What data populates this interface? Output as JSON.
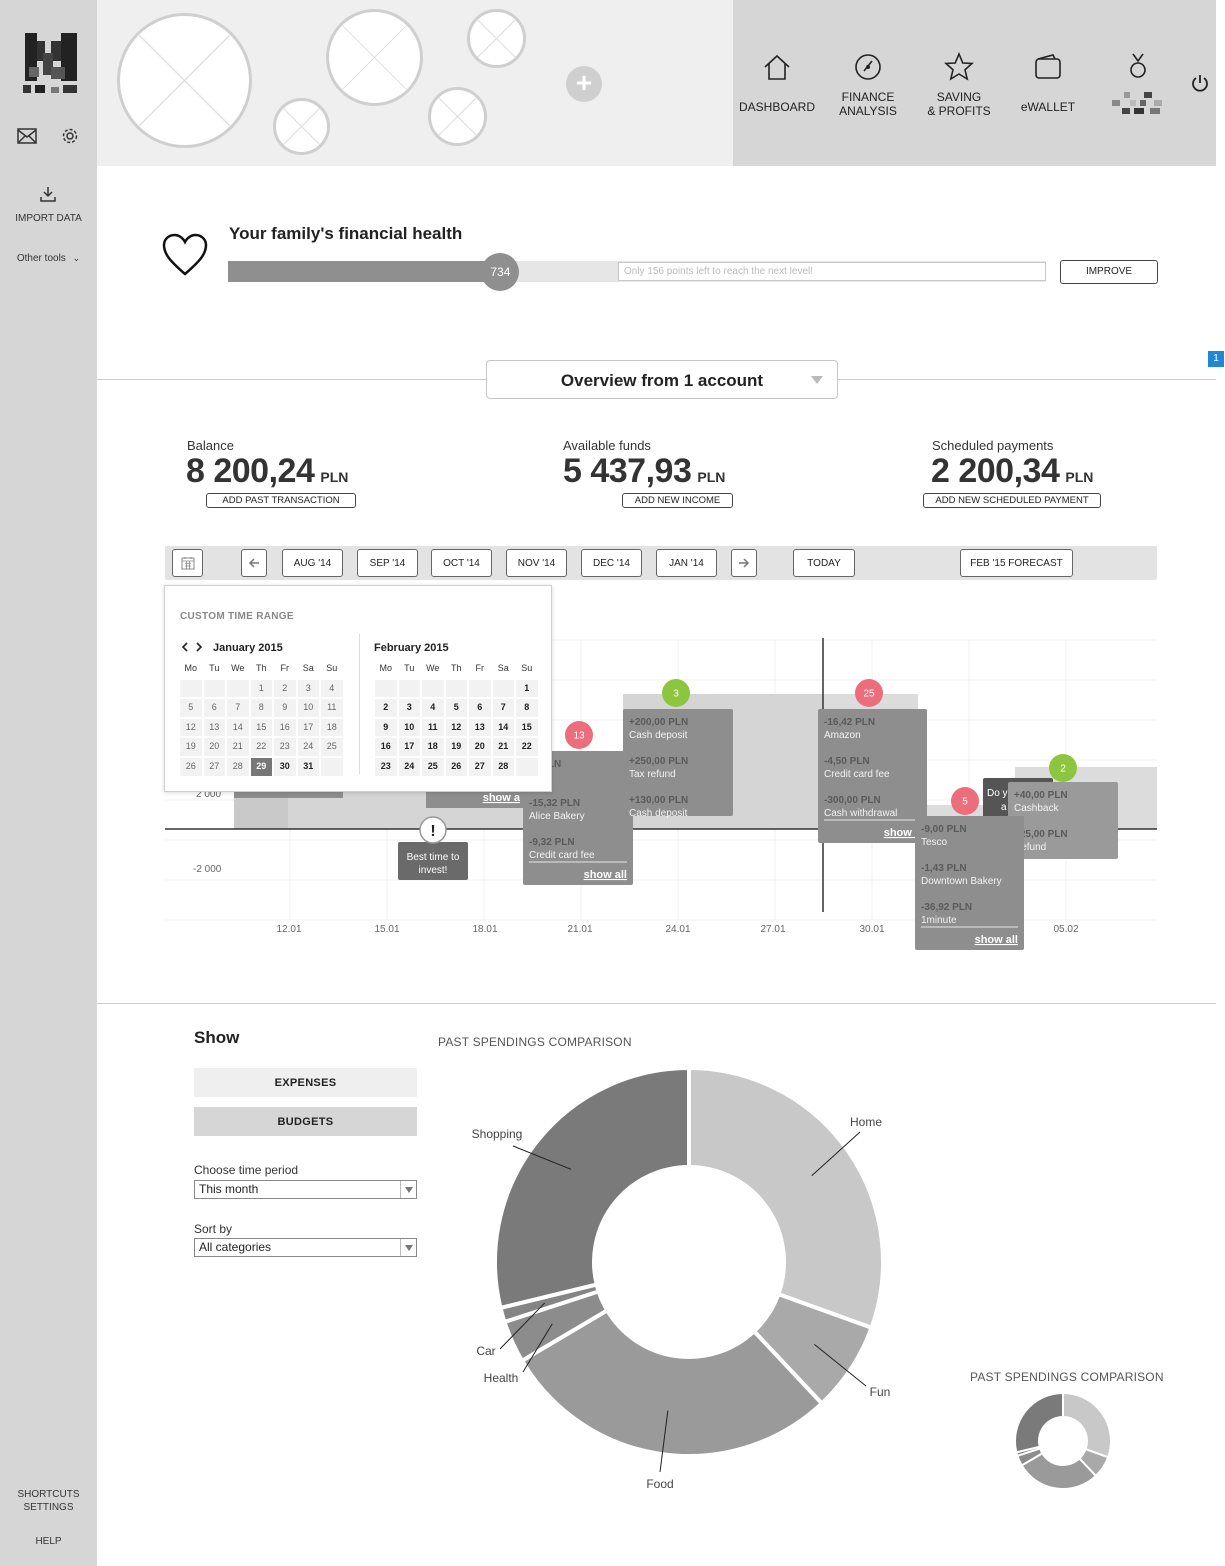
{
  "sidebar": {
    "logo": "logo-mark",
    "import_label": "IMPORT DATA",
    "other_tools_label": "Other tools",
    "shortcuts_label_1": "SHORTCUTS",
    "shortcuts_label_2": "SETTINGS",
    "help_label": "HELP"
  },
  "header": {
    "add_symbol": "+",
    "nav": [
      {
        "label1": "DASHBOARD",
        "label2": "",
        "icon": "home-icon"
      },
      {
        "label1": "FINANCE",
        "label2": "ANALYSIS",
        "icon": "gauge-icon"
      },
      {
        "label1": "SAVING",
        "label2": "& PROFITS",
        "icon": "star-icon"
      },
      {
        "label1": "eWALLET",
        "label2": "",
        "icon": "wallet-icon"
      },
      {
        "label1": "",
        "label2": "",
        "icon": "medal-icon"
      }
    ]
  },
  "health": {
    "title": "Your family's financial health",
    "points": 734,
    "progress_fraction": 0.333,
    "next_level_text": "Only 156 points left to reach the next level!",
    "improve_label": "IMPROVE"
  },
  "overview": {
    "select_label": "Overview from 1 account",
    "corner_badge": "1"
  },
  "stats": {
    "balance_label": "Balance",
    "balance_value": "8 200,24",
    "available_label": "Available funds",
    "available_value": "5 437,93",
    "scheduled_label": "Scheduled payments",
    "scheduled_value": "2 200,34",
    "currency": "PLN",
    "add_past_label": "ADD PAST TRANSACTION",
    "add_income_label": "ADD NEW INCOME",
    "add_scheduled_label": "ADD NEW SCHEDULED PAYMENT"
  },
  "timeline": {
    "months": [
      "AUG '14",
      "SEP '14",
      "OCT '14",
      "NOV '14",
      "DEC '14",
      "JAN '14"
    ],
    "today_label": "TODAY",
    "forecast_label": "FEB '15 FORECAST"
  },
  "calendar": {
    "title": "CUSTOM TIME RANGE",
    "month1": "January 2015",
    "month2": "February 2015",
    "dow": [
      "Mo",
      "Tu",
      "We",
      "Th",
      "Fr",
      "Sa",
      "Su"
    ],
    "selected_day": "29"
  },
  "chart_data": {
    "type": "area",
    "y_ticks": [
      "2 000",
      "-2 000"
    ],
    "x_ticks": [
      "12.01",
      "15.01",
      "18.01",
      "21.01",
      "24.01",
      "27.01",
      "30.01",
      "05.02"
    ],
    "invest_tip": [
      "Best time to",
      "invest!"
    ],
    "tip_fragment": "Do y",
    "tip_fragment2": "a",
    "show_all_label": "show all",
    "show_partial": "show a",
    "cards": [
      {
        "badge": "13",
        "badge_color": "#ec6d7c",
        "items": [
          [
            "-? PLN",
            "...ute"
          ],
          [
            "-15,32 PLN",
            "Alice Bakery"
          ],
          [
            "-9,32 PLN",
            "Credit card fee"
          ]
        ]
      },
      {
        "badge": "3",
        "badge_color": "#8cc63f",
        "items": [
          [
            "+200,00 PLN",
            "Cash deposit"
          ],
          [
            "+250,00 PLN",
            "Tax refund"
          ],
          [
            "+130,00 PLN",
            "Cash deposit"
          ]
        ]
      },
      {
        "badge": "25",
        "badge_color": "#ec6d7c",
        "items": [
          [
            "-16,42 PLN",
            "Amazon"
          ],
          [
            "-4,50 PLN",
            "Credit card fee"
          ],
          [
            "-300,00 PLN",
            "Cash withdrawal"
          ]
        ]
      },
      {
        "badge": "5",
        "badge_color": "#ec6d7c",
        "items": [
          [
            "-9,00 PLN",
            "Tesco"
          ],
          [
            "-1,43 PLN",
            "Downtown Bakery"
          ],
          [
            "-36,92 PLN",
            "1minute"
          ]
        ]
      },
      {
        "badge": "2",
        "badge_color": "#8cc63f",
        "items": [
          [
            "+40,00 PLN",
            "Cashback"
          ],
          [
            "+25,00 PLN",
            "Refund"
          ]
        ]
      }
    ]
  },
  "bottom": {
    "show_title": "Show",
    "expenses_label": "EXPENSES",
    "budgets_label": "BUDGETS",
    "period_label": "Choose time period",
    "period_value": "This month",
    "sort_label": "Sort by",
    "sort_value": "All categories",
    "chart_title": "PAST SPENDINGS COMPARISON",
    "mini_chart_title": "PAST SPENDINGS COMPARISON"
  },
  "donut": {
    "slices": [
      {
        "name": "Home",
        "fraction": 0.305,
        "color": "#c8c8c8"
      },
      {
        "name": "Fun",
        "fraction": 0.075,
        "color": "#a9a9a9"
      },
      {
        "name": "Food",
        "fraction": 0.285,
        "color": "#9a9a9a"
      },
      {
        "name": "Health",
        "fraction": 0.035,
        "color": "#8c8c8c"
      },
      {
        "name": "Car",
        "fraction": 0.012,
        "color": "#858585"
      },
      {
        "name": "Shopping",
        "fraction": 0.288,
        "color": "#7a7a7a"
      }
    ]
  }
}
